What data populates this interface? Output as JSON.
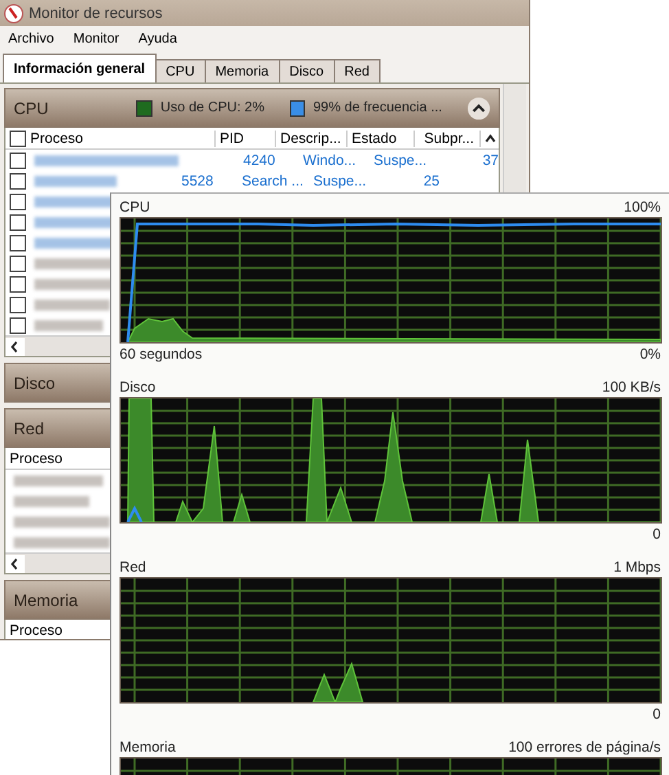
{
  "window": {
    "title": "Monitor de recursos"
  },
  "menu": [
    "Archivo",
    "Monitor",
    "Ayuda"
  ],
  "tabs": [
    {
      "label": "Información general",
      "selected": true
    },
    {
      "label": "CPU",
      "selected": false
    },
    {
      "label": "Memoria",
      "selected": false
    },
    {
      "label": "Disco",
      "selected": false
    },
    {
      "label": "Red",
      "selected": false
    }
  ],
  "sections": [
    {
      "title": "CPU",
      "expanded": true,
      "all_checked": false,
      "legend": [
        {
          "text": "Uso de CPU: 2%",
          "color": "#1f6b1f"
        },
        {
          "text": "99% de frecuencia ...",
          "color": "#3a8ee6"
        }
      ],
      "columns": [
        "Proceso",
        "PID",
        "Descrip...",
        "Estado",
        "Subpr..."
      ],
      "rows": [
        {
          "checked": false,
          "pid": "4240",
          "description": "Windo...",
          "status": "Suspe...",
          "threads": "37"
        },
        {
          "checked": false,
          "pid": "5528",
          "description": "Search ...",
          "status": "Suspe...",
          "threads": "25"
        },
        {
          "checked": false
        },
        {
          "checked": false
        },
        {
          "checked": false
        },
        {
          "checked": false
        },
        {
          "checked": false
        },
        {
          "checked": false
        },
        {
          "checked": false
        }
      ]
    },
    {
      "title": "Disco",
      "expanded": false
    },
    {
      "title": "Red",
      "expanded": true,
      "columns": [
        "Proceso"
      ]
    },
    {
      "title": "Memoria",
      "expanded": true,
      "columns": [
        "Proceso"
      ]
    }
  ],
  "graphs": [
    {
      "title": "CPU",
      "max": "100%",
      "min": "0%",
      "footer": "60 segundos"
    },
    {
      "title": "Disco",
      "max": "100 KB/s",
      "min": "0"
    },
    {
      "title": "Red",
      "max": "1 Mbps",
      "min": "0"
    },
    {
      "title": "Memoria",
      "max": "100 errores de página/s"
    }
  ]
}
